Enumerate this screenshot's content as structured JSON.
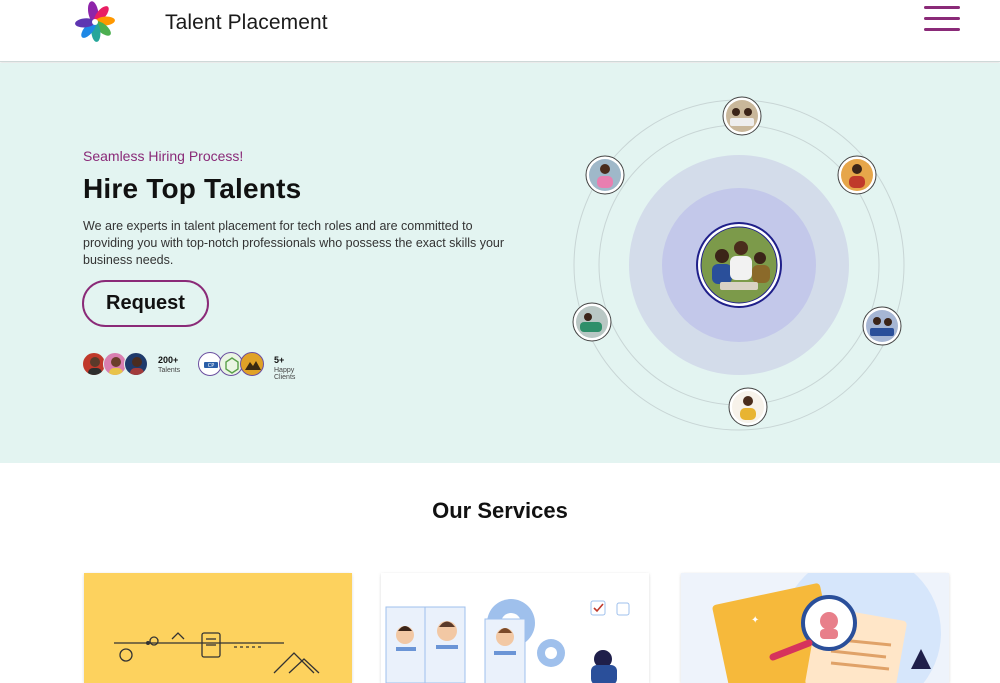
{
  "header": {
    "brand_name": "Talent Placement",
    "logo_icon": "flower-logo-icon",
    "menu_icon": "hamburger-menu-icon"
  },
  "hero": {
    "tagline": "Seamless Hiring Process!",
    "title": "Hire Top Talents",
    "description": "We are experts in talent placement for tech roles and are committed to providing you with top-notch professionals who possess the exact skills your business needs.",
    "request_label": "Request",
    "stats": {
      "talents_count": "200+",
      "talents_label": "Talents",
      "clients_count": "5+",
      "clients_label": "Happy Clients"
    }
  },
  "services": {
    "title": "Our Services"
  },
  "colors": {
    "accent": "#8a2a78",
    "hero_bg": "#e3f4f1",
    "card_yellow": "#fdd25e",
    "orbit_inner": "#c9cdeb",
    "orbit_outer": "#d4dcee"
  }
}
